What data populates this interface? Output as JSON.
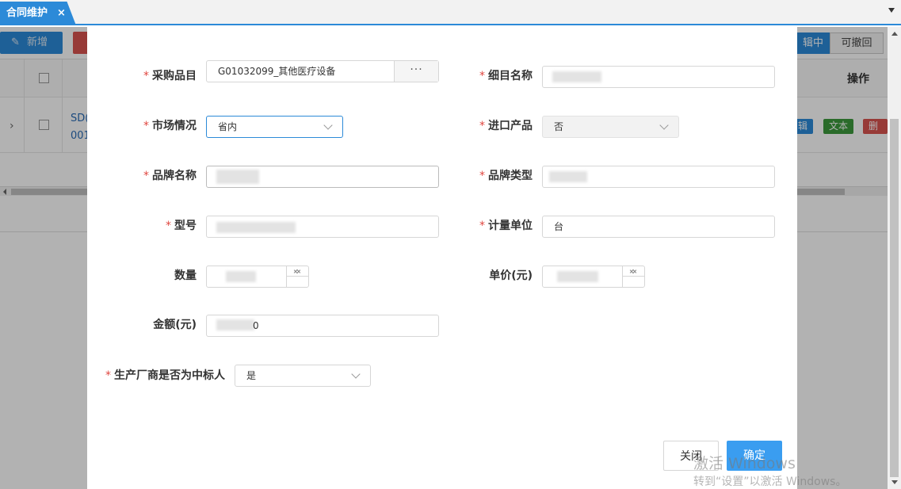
{
  "tabbar": {
    "tab_label": "合同维护",
    "close_symbol": "×"
  },
  "background": {
    "add_button": "新增",
    "seg_mid": "辑中",
    "seg_revoke": "可撤回",
    "header_op": "操作",
    "row_code_line1": "SD(",
    "row_code_line2": "001",
    "row_actions": [
      "辑",
      "文本",
      "删除"
    ]
  },
  "form": {
    "purchase_item": {
      "label": "采购品目",
      "value": "G01032099_其他医疗设备",
      "button": "···"
    },
    "sub_item_name": {
      "label": "细目名称"
    },
    "market": {
      "label": "市场情况",
      "value": "省内"
    },
    "import_product": {
      "label": "进口产品",
      "value": "否"
    },
    "brand_name": {
      "label": "品牌名称"
    },
    "brand_type": {
      "label": "品牌类型"
    },
    "model": {
      "label": "型号"
    },
    "unit": {
      "label": "计量单位",
      "value": "台"
    },
    "quantity": {
      "label": "数量"
    },
    "unit_price": {
      "label": "单价(元)"
    },
    "amount": {
      "label": "金额(元)",
      "value_tail": "0"
    },
    "is_winner": {
      "label": "生产厂商是否为中标人",
      "value": "是"
    }
  },
  "buttons": {
    "close": "关闭",
    "ok": "确定"
  },
  "watermark": {
    "line1": "激活 Windows",
    "line2": "转到“设置”以激活 Windows。"
  },
  "colors": {
    "accent": "#2c8ad8",
    "required": "#e0463f",
    "ok_button": "#3a9df0"
  }
}
